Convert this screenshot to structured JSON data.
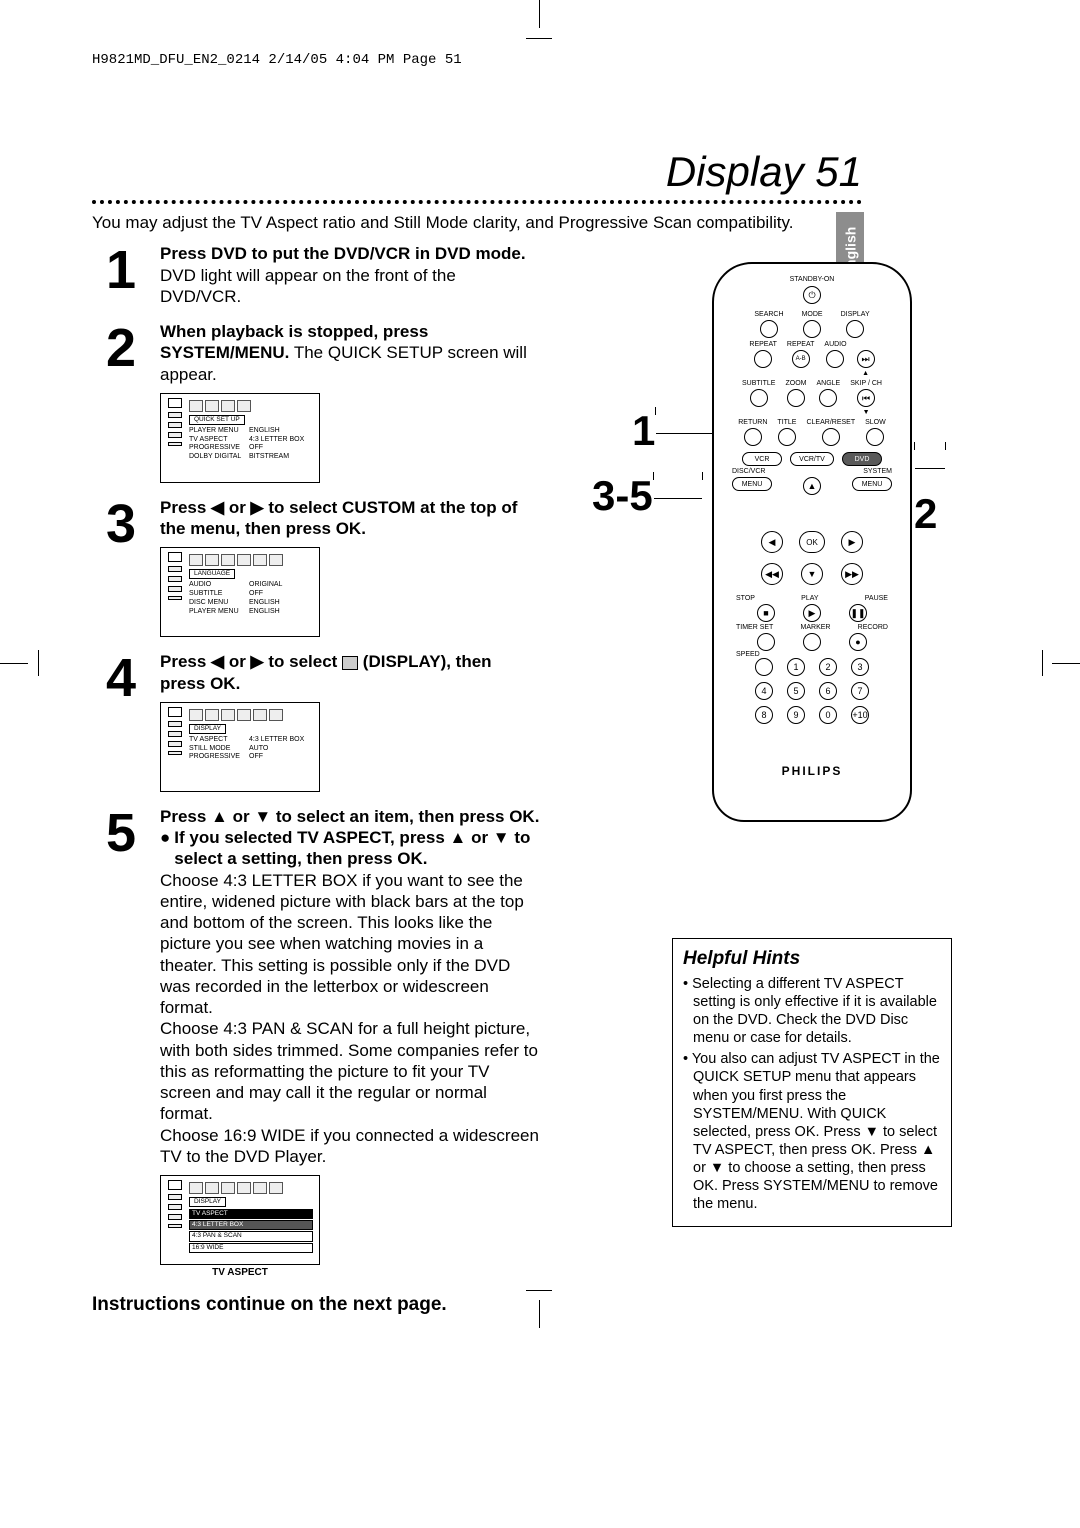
{
  "doc_tag": "H9821MD_DFU_EN2_0214  2/14/05  4:04 PM  Page 51",
  "page_title": "Display  51",
  "language_tab": "English",
  "intro": "You may adjust the TV Aspect ratio and Still Mode clarity, and Progressive Scan compatibility.",
  "steps": {
    "s1": {
      "num": "1",
      "bold": "Press DVD to put the DVD/VCR in DVD mode.",
      "text": " DVD light will appear on the front of the DVD/VCR."
    },
    "s2": {
      "num": "2",
      "bold1": "When playback is stopped, press SYSTEM/MENU.",
      "text": " The QUICK SETUP screen will appear.",
      "screen": {
        "tab": "QUICK SET UP",
        "rows": [
          {
            "k": "PLAYER MENU",
            "v": "ENGLISH"
          },
          {
            "k": "TV ASPECT",
            "v": "4:3 LETTER BOX"
          },
          {
            "k": "PROGRESSIVE",
            "v": "OFF"
          },
          {
            "k": "DOLBY DIGITAL",
            "v": "BITSTREAM"
          }
        ]
      }
    },
    "s3": {
      "num": "3",
      "bold": "Press ◀ or ▶ to select CUSTOM at the top of the menu, then press OK.",
      "screen": {
        "tab": "LANGUAGE",
        "rows": [
          {
            "k": "AUDIO",
            "v": "ORIGINAL"
          },
          {
            "k": "SUBTITLE",
            "v": "OFF"
          },
          {
            "k": "DISC MENU",
            "v": "ENGLISH"
          },
          {
            "k": "PLAYER MENU",
            "v": "ENGLISH"
          }
        ]
      }
    },
    "s4": {
      "num": "4",
      "bold_a": "Press ◀ or ▶ to select ",
      "icon_alt": "(DISPLAY)",
      "bold_b": "(DISPLAY), then press OK.",
      "screen": {
        "tab": "DISPLAY",
        "rows": [
          {
            "k": "TV ASPECT",
            "v": "4:3 LETTER BOX"
          },
          {
            "k": "STILL MODE",
            "v": "AUTO"
          },
          {
            "k": "PROGRESSIVE",
            "v": "OFF"
          }
        ]
      }
    },
    "s5": {
      "num": "5",
      "bold1": "Press ▲ or ▼ to select an item, then press OK.",
      "bullet_bold": "If you selected TV ASPECT, press ▲ or ▼ to select a setting, then press OK.",
      "para1": "Choose 4:3 LETTER BOX if you want to see the entire, widened picture with black bars at the top and bottom of the screen. This looks like the picture you see when watching movies in a theater.  This setting is possible only if the DVD was recorded in the letterbox or widescreen format.",
      "para2": "Choose 4:3 PAN & SCAN for a full height picture, with both sides trimmed. Some companies refer to this as reformatting the picture to fit your TV screen and may call it the regular or normal format.",
      "para3": "Choose 16:9 WIDE if you connected a widescreen TV to the DVD Player.",
      "screen": {
        "tab": "DISPLAY",
        "hdr": "TV ASPECT",
        "opts": [
          "4:3 LETTER BOX",
          "4:3 PAN & SCAN",
          "16:9 WIDE"
        ]
      },
      "caption": "TV ASPECT"
    }
  },
  "continue": "Instructions continue on the next page.",
  "remote": {
    "standby": "STANDBY-ON",
    "row1": [
      "SEARCH",
      "MODE",
      "DISPLAY"
    ],
    "row2": [
      "REPEAT",
      "REPEAT",
      "AUDIO"
    ],
    "row2_sub": "A-B",
    "row3": [
      "SUBTITLE",
      "ZOOM",
      "ANGLE",
      "SKIP / CH"
    ],
    "row4": [
      "RETURN",
      "TITLE",
      "CLEAR/RESET",
      "SLOW"
    ],
    "mode_row": [
      "VCR",
      "VCR/TV",
      "DVD"
    ],
    "discvcr": "DISC/VCR",
    "system": "SYSTEM",
    "menu": "MENU",
    "ok": "OK",
    "transport": {
      "stop": "STOP",
      "play": "PLAY",
      "pause": "PAUSE"
    },
    "tset": "TIMER SET",
    "marker": "MARKER",
    "record": "RECORD",
    "speed": "SPEED",
    "numpad": [
      "1",
      "2",
      "3",
      "4",
      "5",
      "6",
      "7",
      "8",
      "9",
      "0",
      "+10"
    ],
    "brand": "PHILIPS"
  },
  "callouts": {
    "c1": "1",
    "c2": "2",
    "c35": "3-5"
  },
  "hints": {
    "title": "Helpful Hints",
    "items": [
      "Selecting a different TV ASPECT setting is only effective if it is available on the DVD. Check the DVD Disc menu or case for details.",
      "You also can adjust TV ASPECT in the QUICK SETUP menu that appears when you first press the SYSTEM/MENU. With QUICK selected, press OK. Press ▼ to select TV ASPECT, then press OK. Press ▲ or ▼ to choose a setting, then press OK. Press SYSTEM/MENU to remove the menu."
    ]
  }
}
